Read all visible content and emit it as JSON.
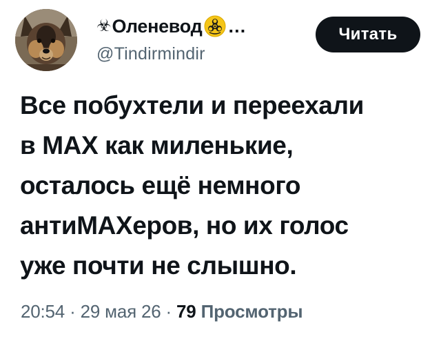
{
  "author": {
    "prefix_glyph": "☣",
    "display_name": "Оленевод",
    "badge_icon": "biohazard-badge-icon",
    "ellipsis": "…",
    "handle": "@Tindirmindir",
    "avatar_icon": "dog-avatar"
  },
  "actions": {
    "read_label": "Читать"
  },
  "tweet": {
    "lines": [
      "Все побухтели и переехали",
      "в MAX как миленькие,",
      "осталось ещё немного",
      "антиMAXеров, но их голос",
      "уже почти не слышно."
    ]
  },
  "meta": {
    "time": "20:54",
    "separator": "·",
    "date": "29 мая 26",
    "views_count": "79",
    "views_label": "Просмотры"
  },
  "colors": {
    "text": "#0f1419",
    "muted": "#536471",
    "button_bg": "#0f1419",
    "badge": "#f5c518"
  }
}
